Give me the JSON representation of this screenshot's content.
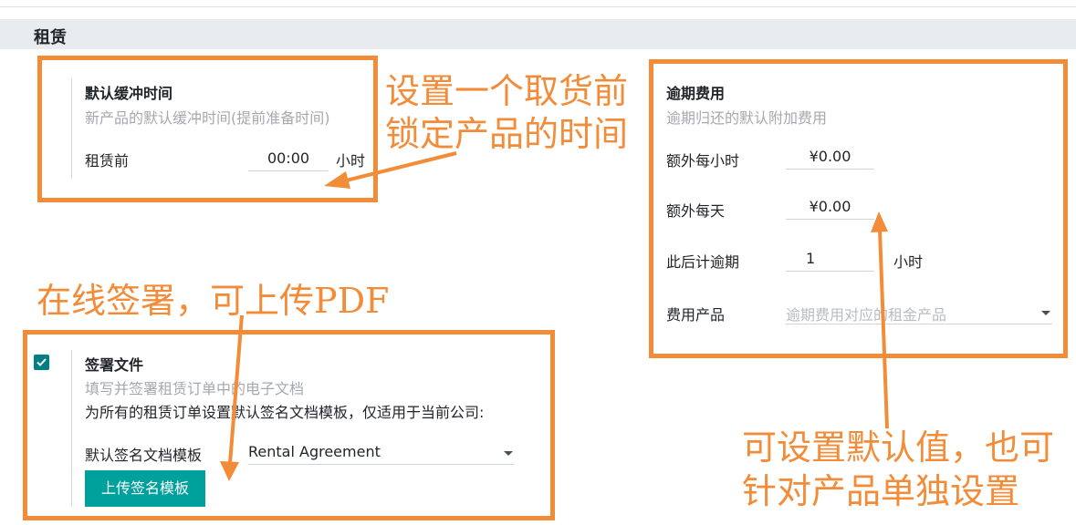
{
  "section": {
    "title": "租赁"
  },
  "buffer": {
    "title": "默认缓冲时间",
    "description": "新产品的默认缓冲时间(提前准备时间)",
    "field_label": "租赁前",
    "value": "00:00",
    "unit": "小时"
  },
  "late_fees": {
    "title": "逾期费用",
    "description": "逾期归还的默认附加费用",
    "extra_hour_label": "额外每小时",
    "extra_hour_value": "¥0.00",
    "extra_day_label": "额外每天",
    "extra_day_value": "¥0.00",
    "late_after_label": "此后计逾期",
    "late_after_value": "1",
    "late_after_unit": "小时",
    "fee_product_label": "费用产品",
    "fee_product_placeholder": "逾期费用对应的租金产品"
  },
  "sign": {
    "checked": true,
    "title": "签署文件",
    "description": "填写并签署租赁订单中的电子文档",
    "note": "为所有的租赁订单设置默认签名文档模板，仅适用于当前公司:",
    "template_label": "默认签名文档模板",
    "template_value": "Rental Agreement",
    "upload_label": "上传签名模板"
  },
  "annotations": {
    "buffer_line1": "设置一个取货前",
    "buffer_line2": "锁定产品的时间",
    "sign": "在线签署，可上传PDF",
    "fees_line1": "可设置默认值，也可",
    "fees_line2": "针对产品单独设置"
  },
  "colors": {
    "highlight": "#f28c38",
    "primary_button": "#00a09d",
    "checkbox": "#017e84"
  }
}
